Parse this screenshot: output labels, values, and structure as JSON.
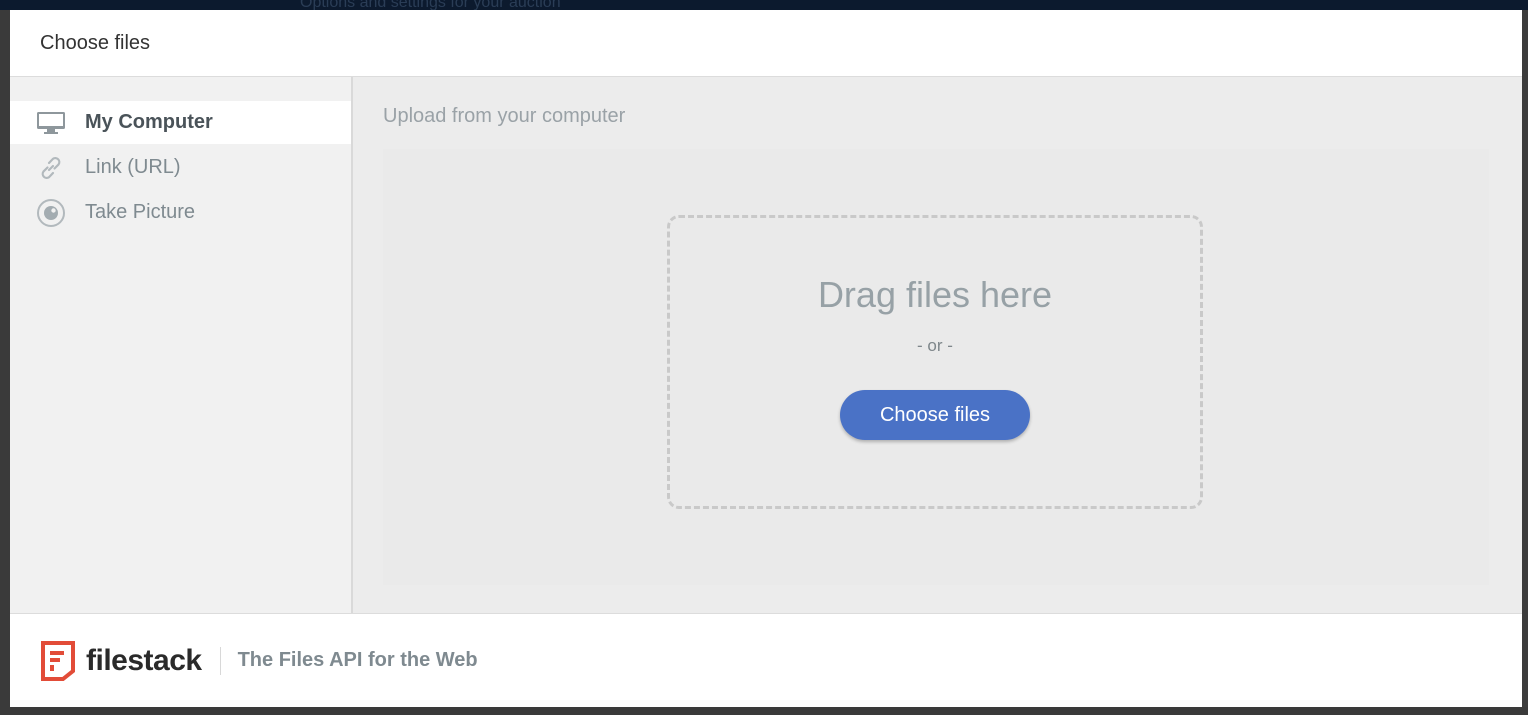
{
  "background": {
    "peek_text": "Options and settings for your auction"
  },
  "modal": {
    "title": "Choose files"
  },
  "sidebar": {
    "items": [
      {
        "label": "My Computer",
        "icon": "monitor-icon",
        "active": true
      },
      {
        "label": "Link (URL)",
        "icon": "link-icon",
        "active": false
      },
      {
        "label": "Take Picture",
        "icon": "camera-icon",
        "active": false
      }
    ]
  },
  "main": {
    "section_title": "Upload from your computer",
    "drop_text": "Drag files here",
    "or_text": "- or -",
    "choose_button": "Choose files"
  },
  "footer": {
    "brand": "filestack",
    "tagline": "The Files API for the Web"
  },
  "colors": {
    "accent": "#4a72c6",
    "brand_red": "#e24c38",
    "sidebar_bg": "#f1f1f1",
    "main_bg": "#ececec"
  }
}
